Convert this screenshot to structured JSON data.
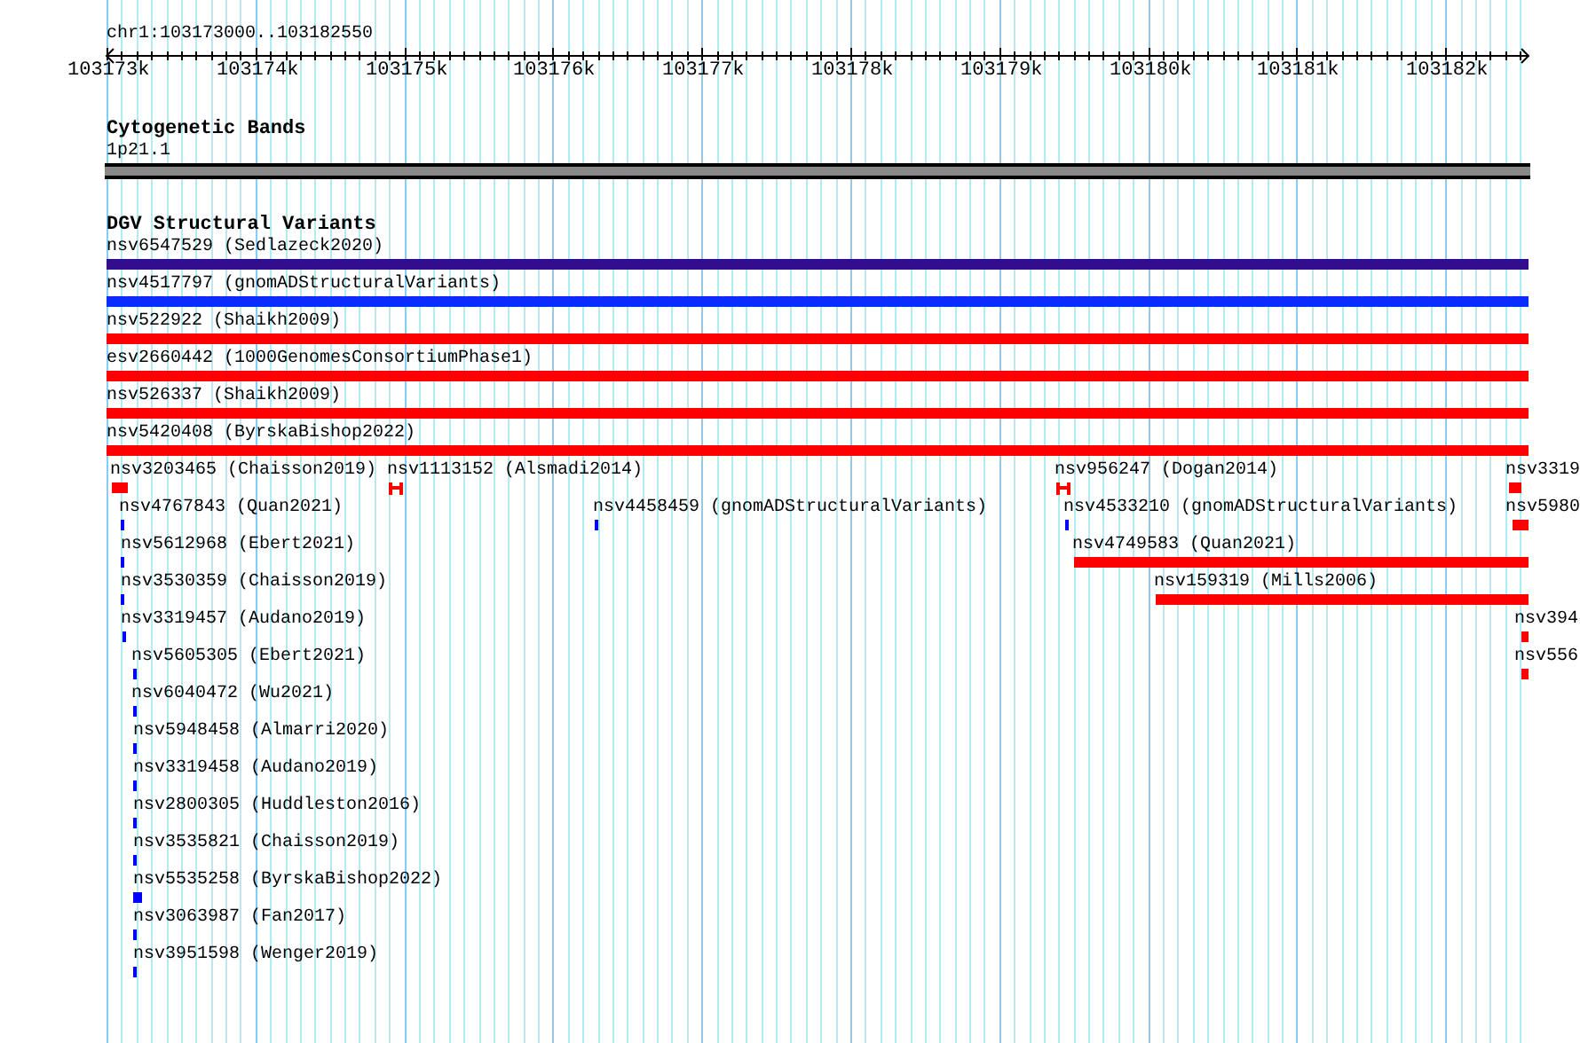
{
  "locus": "chr1:103173000..103182550",
  "axis": {
    "ticks": [
      "103173k",
      "103174k",
      "103175k",
      "103176k",
      "103177k",
      "103178k",
      "103179k",
      "103180k",
      "103181k",
      "103182k"
    ]
  },
  "tracks": [
    {
      "title": "Cytogenetic Bands",
      "features": [
        {
          "label": "1p21.1",
          "color": "#888888",
          "kind": "band"
        }
      ]
    },
    {
      "title": "DGV Structural Variants",
      "features": [
        {
          "label": "nsv6547529 (Sedlazeck2020)",
          "color": "#330e8c",
          "kind": "bar"
        },
        {
          "label": "nsv4517797 (gnomADStructuralVariants)",
          "color": "#0a2cff",
          "kind": "bar"
        },
        {
          "label": "nsv522922 (Shaikh2009)",
          "color": "#ff0000",
          "kind": "bar"
        },
        {
          "label": "esv2660442 (1000GenomesConsortiumPhase1)",
          "color": "#ff0000",
          "kind": "bar"
        },
        {
          "label": "nsv526337 (Shaikh2009)",
          "color": "#ff0000",
          "kind": "bar"
        },
        {
          "label": "nsv5420408 (ByrskaBishop2022)",
          "color": "#ff0000",
          "kind": "bar"
        },
        {
          "label": "nsv3203465 (Chaisson2019)",
          "color": "#ff0000",
          "kind": "bar"
        },
        {
          "label": "nsv1113152 (Alsmadi2014)",
          "color": "#ff0000",
          "kind": "h"
        },
        {
          "label": "nsv956247 (Dogan2014)",
          "color": "#ff0000",
          "kind": "h"
        },
        {
          "label": "nsv3319",
          "color": "#ff0000",
          "kind": "bar"
        },
        {
          "label": "nsv4767843 (Quan2021)",
          "color": "#0000ff",
          "kind": "bar"
        },
        {
          "label": "nsv4458459 (gnomADStructuralVariants)",
          "color": "#0000ff",
          "kind": "bar"
        },
        {
          "label": "nsv4533210 (gnomADStructuralVariants)",
          "color": "#0000ff",
          "kind": "bar"
        },
        {
          "label": "nsv5980",
          "color": "#ff0000",
          "kind": "bar"
        },
        {
          "label": "nsv5612968 (Ebert2021)",
          "color": "#0000ff",
          "kind": "bar"
        },
        {
          "label": "nsv4749583 (Quan2021)",
          "color": "#ff0000",
          "kind": "bar"
        },
        {
          "label": "nsv3530359 (Chaisson2019)",
          "color": "#0000ff",
          "kind": "bar"
        },
        {
          "label": "nsv159319 (Mills2006)",
          "color": "#ff0000",
          "kind": "bar"
        },
        {
          "label": "nsv3319457 (Audano2019)",
          "color": "#0000ff",
          "kind": "bar"
        },
        {
          "label": "nsv394",
          "color": "#ff0000",
          "kind": "bar"
        },
        {
          "label": "nsv5605305 (Ebert2021)",
          "color": "#0000ff",
          "kind": "bar"
        },
        {
          "label": "nsv556",
          "color": "#ff0000",
          "kind": "bar"
        },
        {
          "label": "nsv6040472 (Wu2021)",
          "color": "#0000ff",
          "kind": "bar"
        },
        {
          "label": "nsv5948458 (Almarri2020)",
          "color": "#0000ff",
          "kind": "bar"
        },
        {
          "label": "nsv3319458 (Audano2019)",
          "color": "#0000ff",
          "kind": "bar"
        },
        {
          "label": "nsv2800305 (Huddleston2016)",
          "color": "#0000ff",
          "kind": "bar"
        },
        {
          "label": "nsv3535821 (Chaisson2019)",
          "color": "#0000ff",
          "kind": "bar"
        },
        {
          "label": "nsv5535258 (ByrskaBishop2022)",
          "color": "#0000ff",
          "kind": "bar"
        },
        {
          "label": "nsv3063987 (Fan2017)",
          "color": "#0000ff",
          "kind": "bar"
        },
        {
          "label": "nsv3951598 (Wenger2019)",
          "color": "#0000ff",
          "kind": "bar"
        }
      ]
    }
  ]
}
